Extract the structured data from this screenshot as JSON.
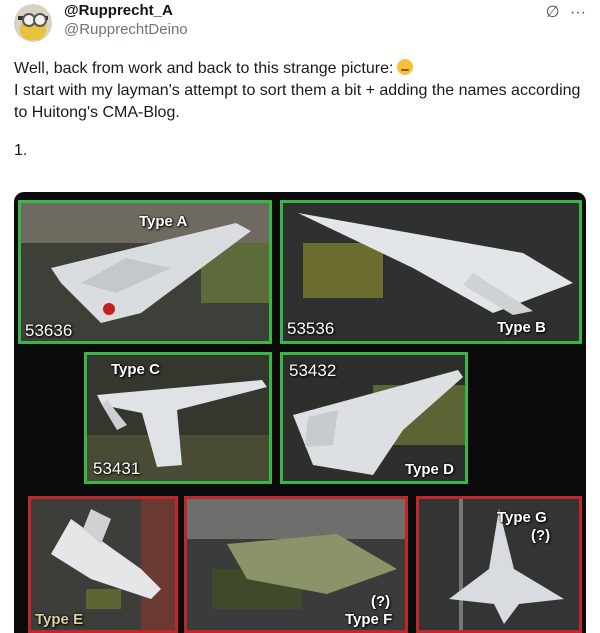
{
  "post": {
    "display_name": "@Rupprecht_A",
    "handle": "@RupprechtDeino",
    "header_icons": [
      "slash-icon",
      "more-icon"
    ],
    "text_line1": "Well, back from work and back to this strange picture:",
    "text_line2": "I start with my layman's attempt to sort them a bit + adding the names according to Huitong's CMA-Blog.",
    "text_line3": "1."
  },
  "mosaic": {
    "panels": [
      {
        "type_label": "Type A",
        "serial": "53636",
        "border": "green"
      },
      {
        "type_label": "Type B",
        "serial": "53536",
        "border": "green"
      },
      {
        "type_label": "Type C",
        "serial": "53431",
        "border": "green"
      },
      {
        "type_label": "Type D",
        "serial": "53432",
        "border": "green"
      },
      {
        "type_label": "Type E",
        "border": "red"
      },
      {
        "type_label": "Type F",
        "note": "(?)",
        "border": "red"
      },
      {
        "type_label": "Type G",
        "note": "(?)",
        "border": "red"
      }
    ]
  }
}
